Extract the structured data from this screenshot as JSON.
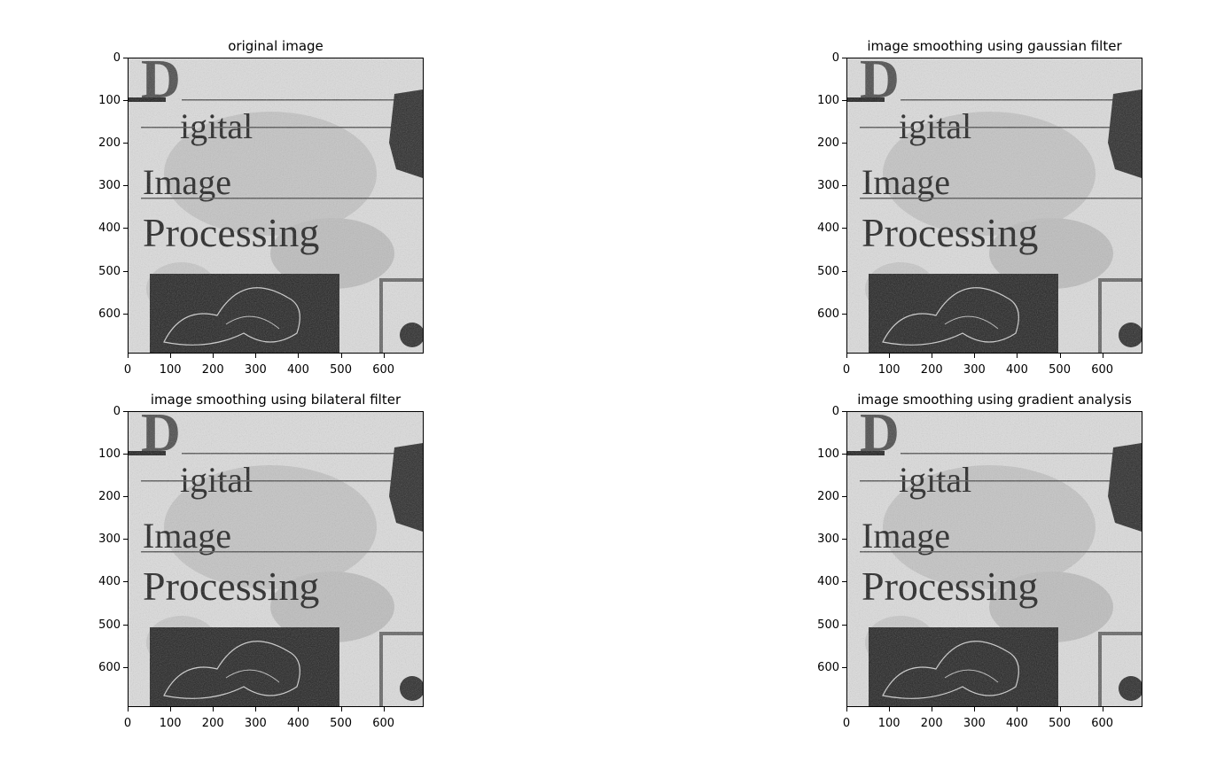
{
  "figure": {
    "panels": [
      {
        "title": "original image",
        "xticks": [
          "0",
          "100",
          "200",
          "300",
          "400",
          "500",
          "600"
        ],
        "yticks": [
          "0",
          "100",
          "200",
          "300",
          "400",
          "500",
          "600"
        ]
      },
      {
        "title": "image smoothing using gaussian filter",
        "xticks": [
          "0",
          "100",
          "200",
          "300",
          "400",
          "500",
          "600"
        ],
        "yticks": [
          "0",
          "100",
          "200",
          "300",
          "400",
          "500",
          "600"
        ]
      },
      {
        "title": "image smoothing using bilateral filter",
        "xticks": [
          "0",
          "100",
          "200",
          "300",
          "400",
          "500",
          "600"
        ],
        "yticks": [
          "0",
          "100",
          "200",
          "300",
          "400",
          "500",
          "600"
        ]
      },
      {
        "title": "image smoothing using gradient analysis",
        "xticks": [
          "0",
          "100",
          "200",
          "300",
          "400",
          "500",
          "600"
        ],
        "yticks": [
          "0",
          "100",
          "200",
          "300",
          "400",
          "500",
          "600"
        ]
      }
    ],
    "image_text": {
      "big_letter": "D",
      "line1": "igital",
      "line2": "Image",
      "line3": "Processing"
    },
    "colors": {
      "paper": "#dcdcdc",
      "ink": "#1e1e1e",
      "grey_letter": "#4a4a4a",
      "dark_block": "#232323"
    }
  }
}
